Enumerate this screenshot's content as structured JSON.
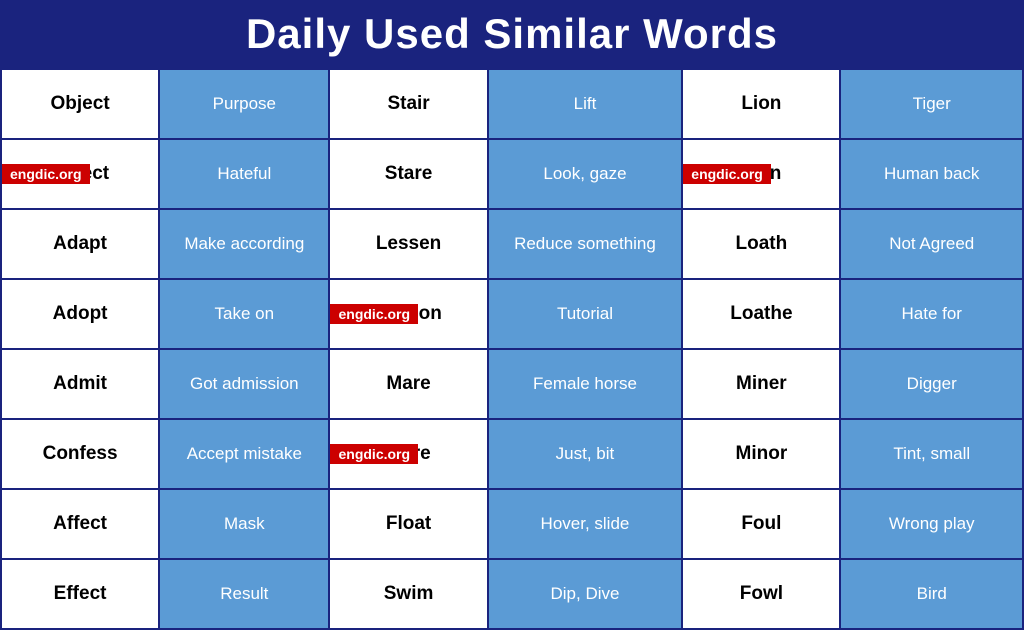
{
  "header": {
    "title": "Daily Used Similar Words"
  },
  "watermarks": [
    "engdic.org",
    "engdic.org",
    "engdic.org",
    "engdic.org"
  ],
  "rows": [
    [
      {
        "text": "Object",
        "type": "word"
      },
      {
        "text": "Purpose",
        "type": "def"
      },
      {
        "text": "Stair",
        "type": "word"
      },
      {
        "text": "Lift",
        "type": "def"
      },
      {
        "text": "Lion",
        "type": "word"
      },
      {
        "text": "Tiger",
        "type": "def"
      }
    ],
    [
      {
        "text": "Abject",
        "type": "word",
        "wm": true
      },
      {
        "text": "Hateful",
        "type": "def"
      },
      {
        "text": "Stare",
        "type": "word"
      },
      {
        "text": "Look, gaze",
        "type": "def"
      },
      {
        "text": "Loin",
        "type": "word",
        "wm2": true
      },
      {
        "text": "Human back",
        "type": "def"
      }
    ],
    [
      {
        "text": "Adapt",
        "type": "word"
      },
      {
        "text": "Make according",
        "type": "def"
      },
      {
        "text": "Lessen",
        "type": "word"
      },
      {
        "text": "Reduce something",
        "type": "def"
      },
      {
        "text": "Loath",
        "type": "word"
      },
      {
        "text": "Not Agreed",
        "type": "def"
      }
    ],
    [
      {
        "text": "Adopt",
        "type": "word"
      },
      {
        "text": "Take on",
        "type": "def"
      },
      {
        "text": "Lesson",
        "type": "word",
        "wm3": true
      },
      {
        "text": "Tutorial",
        "type": "def"
      },
      {
        "text": "Loathe",
        "type": "word"
      },
      {
        "text": "Hate for",
        "type": "def"
      }
    ],
    [
      {
        "text": "Admit",
        "type": "word"
      },
      {
        "text": "Got admission",
        "type": "def"
      },
      {
        "text": "Mare",
        "type": "word"
      },
      {
        "text": "Female horse",
        "type": "def"
      },
      {
        "text": "Miner",
        "type": "word"
      },
      {
        "text": "Digger",
        "type": "def"
      }
    ],
    [
      {
        "text": "Confess",
        "type": "word"
      },
      {
        "text": "Accept mistake",
        "type": "def"
      },
      {
        "text": "Mere",
        "type": "word",
        "wm4": true
      },
      {
        "text": "Just, bit",
        "type": "def"
      },
      {
        "text": "Minor",
        "type": "word"
      },
      {
        "text": "Tint, small",
        "type": "def"
      }
    ],
    [
      {
        "text": "Affect",
        "type": "word"
      },
      {
        "text": "Mask",
        "type": "def"
      },
      {
        "text": "Float",
        "type": "word"
      },
      {
        "text": "Hover, slide",
        "type": "def"
      },
      {
        "text": "Foul",
        "type": "word"
      },
      {
        "text": "Wrong play",
        "type": "def"
      }
    ],
    [
      {
        "text": "Effect",
        "type": "word"
      },
      {
        "text": "Result",
        "type": "def"
      },
      {
        "text": "Swim",
        "type": "word"
      },
      {
        "text": "Dip, Dive",
        "type": "def"
      },
      {
        "text": "Fowl",
        "type": "word"
      },
      {
        "text": "Bird",
        "type": "def"
      }
    ]
  ]
}
